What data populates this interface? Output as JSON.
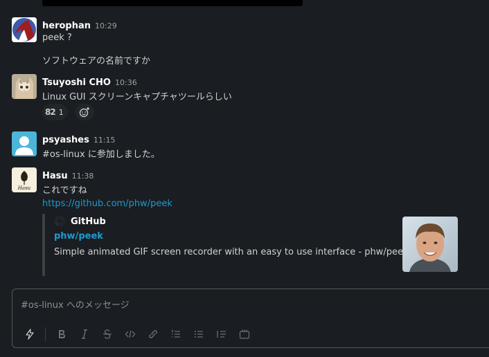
{
  "messages": [
    {
      "author": "herophan",
      "time": "10:29",
      "lines": [
        "peek ?",
        "ソフトウェアの名前ですか"
      ]
    },
    {
      "author": "Tsuyoshi CHO",
      "time": "10:36",
      "lines": [
        "Linux GUI スクリーンキャプチャツールらしい"
      ],
      "reaction": {
        "emoji": "82",
        "count": "1"
      }
    },
    {
      "author": "psyashes",
      "time": "11:15",
      "lines": [
        "#os-linux に参加しました。"
      ]
    },
    {
      "author": "Hasu",
      "time": "11:38",
      "lines": [
        "これですね"
      ],
      "link": "https://github.com/phw/peek",
      "unfurl": {
        "site": "GitHub",
        "title": "phw/peek",
        "description": "Simple animated GIF screen recorder with an easy to use interface - phw/peek"
      },
      "avatar_text": "Hasu"
    }
  ],
  "composer": {
    "placeholder": "#os-linux へのメッセージ",
    "tools": [
      "shortcuts-icon",
      "bold-icon",
      "italic-icon",
      "strike-icon",
      "code-icon",
      "link-icon",
      "ordered-list-icon",
      "bulleted-list-icon",
      "blockquote-icon",
      "code-block-icon"
    ]
  },
  "colors": {
    "background": "#1a1d21",
    "link": "#1d9bd1",
    "text": "#d1d2d3",
    "muted": "#a0a1a3"
  }
}
